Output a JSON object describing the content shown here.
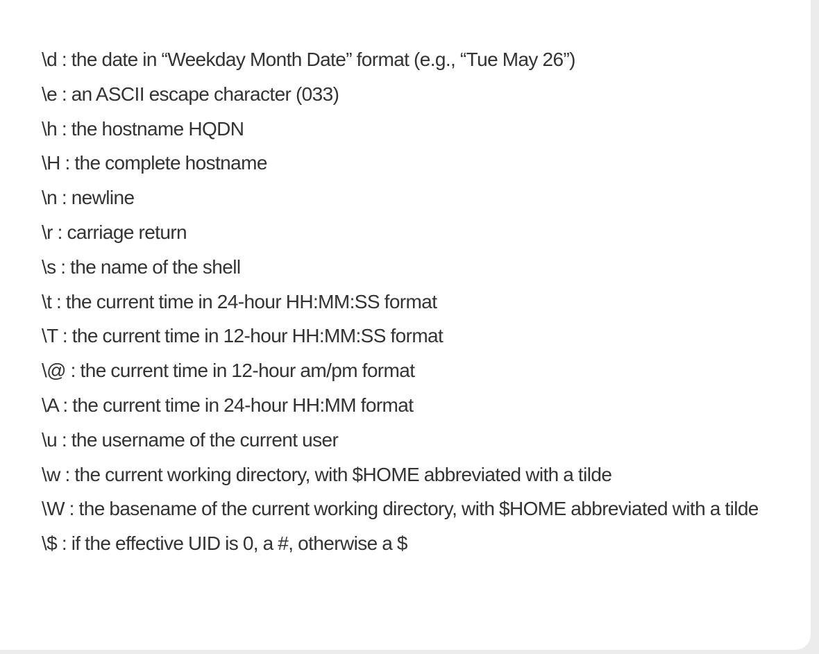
{
  "prompt_escapes": [
    "\\d : the date in “Weekday Month Date” format (e.g., “Tue May 26”)",
    "\\e : an ASCII escape character (033)",
    "\\h : the hostname HQDN",
    "\\H : the complete hostname",
    "\\n : newline",
    "\\r : carriage return",
    "\\s : the name of the shell",
    "\\t : the current time in 24-hour HH:MM:SS format",
    "\\T : the current time in 12-hour HH:MM:SS format",
    "\\@ : the current time in 12-hour am/pm format",
    "\\A : the current time in 24-hour HH:MM format",
    "\\u : the username of the current user",
    "\\w : the current working directory, with $HOME abbreviated with a tilde",
    "\\W : the basename of the current working directory, with $HOME abbreviated with a tilde",
    "\\$ : if the effective UID is 0, a #, otherwise a $"
  ]
}
